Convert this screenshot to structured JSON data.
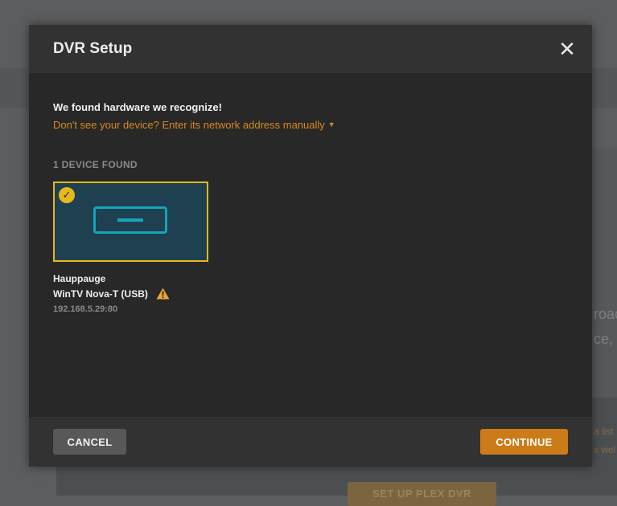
{
  "background": {
    "fragments": [
      "roac",
      "ce, ",
      "a list",
      "s wel"
    ],
    "button_label": "SET UP PLEX DVR"
  },
  "dialog": {
    "title": "DVR Setup",
    "close_icon": "close-icon",
    "found_message": "We found hardware we recognize!",
    "manual_link": "Don't see your device? Enter its network address manually",
    "device_count_label": "1 DEVICE FOUND",
    "devices": [
      {
        "brand": "Hauppauge",
        "model": "WinTV Nova-T (USB)",
        "address": "192.168.5.29:80",
        "selected": true,
        "icons": [
          "check-icon",
          "tuner-device-icon",
          "warning-icon"
        ]
      }
    ],
    "cancel_label": "CANCEL",
    "continue_label": "CONTINUE"
  },
  "colors": {
    "accent": "#cc7b19",
    "selection": "#e5b91a",
    "tile": "#1e4051",
    "tuner": "#17a4b7",
    "warning": "#f0a33a"
  }
}
